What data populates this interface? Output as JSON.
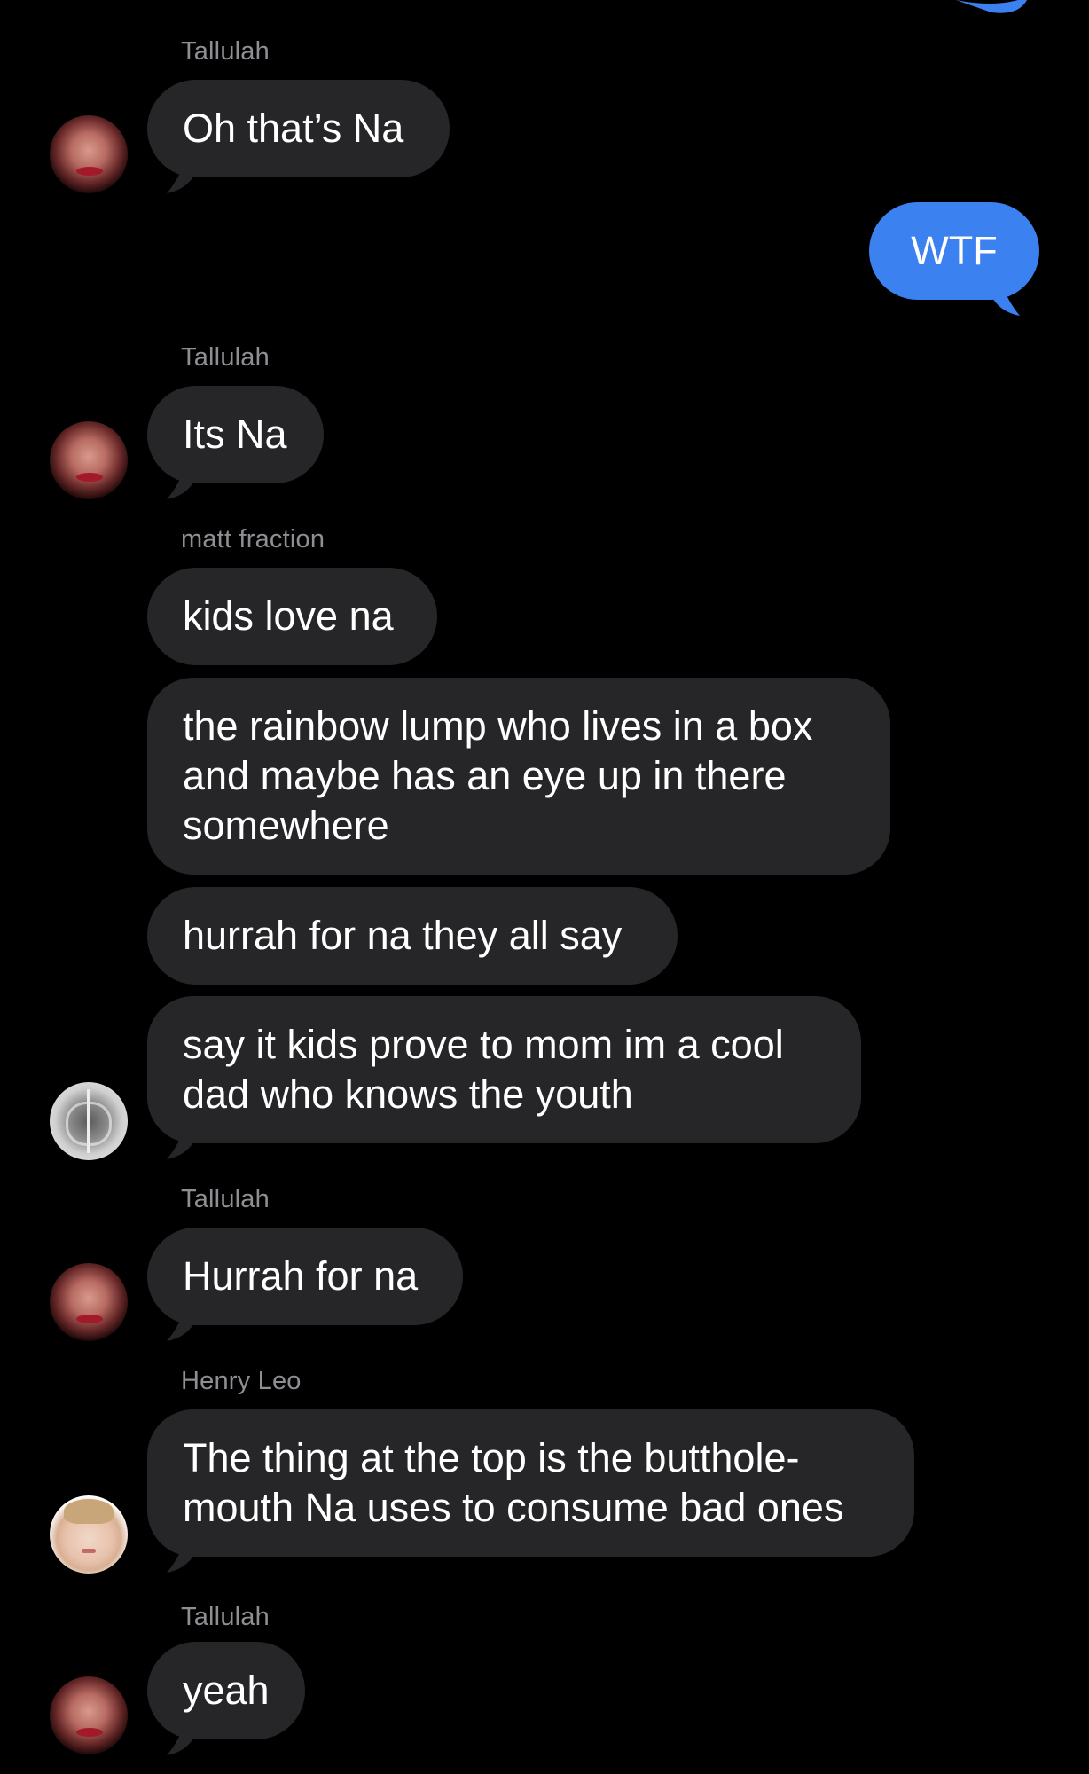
{
  "colors": {
    "background": "#000000",
    "incoming_bubble": "#262628",
    "outgoing_bubble": "#3b82f0",
    "sender_label": "#8e8e93",
    "text": "#ffffff"
  },
  "messages": [
    {
      "sender": "Tallulah",
      "text": "Oh that’s Na",
      "direction": "incoming",
      "avatar": "tallulah-avatar"
    },
    {
      "text": "WTF",
      "direction": "outgoing"
    },
    {
      "sender": "Tallulah",
      "text": "Its Na",
      "direction": "incoming",
      "avatar": "tallulah-avatar"
    },
    {
      "sender": "matt fraction",
      "text": "kids love na",
      "direction": "incoming"
    },
    {
      "text": "the rainbow lump who lives in a box\nand maybe has an eye up in there\nsomewhere",
      "direction": "incoming"
    },
    {
      "text": "hurrah for na they all say",
      "direction": "incoming"
    },
    {
      "text": "say it kids prove to mom im a cool\ndad who knows the youth",
      "direction": "incoming",
      "avatar": "xray-avatar"
    },
    {
      "sender": "Tallulah",
      "text": "Hurrah for na",
      "direction": "incoming",
      "avatar": "tallulah-avatar"
    },
    {
      "sender": "Henry Leo",
      "text": "The thing at the top is the butthole-\nmouth Na uses to consume bad ones",
      "direction": "incoming",
      "avatar": "henry-avatar"
    },
    {
      "sender": "Tallulah",
      "text": "yeah",
      "direction": "incoming",
      "avatar": "tallulah-avatar"
    }
  ]
}
